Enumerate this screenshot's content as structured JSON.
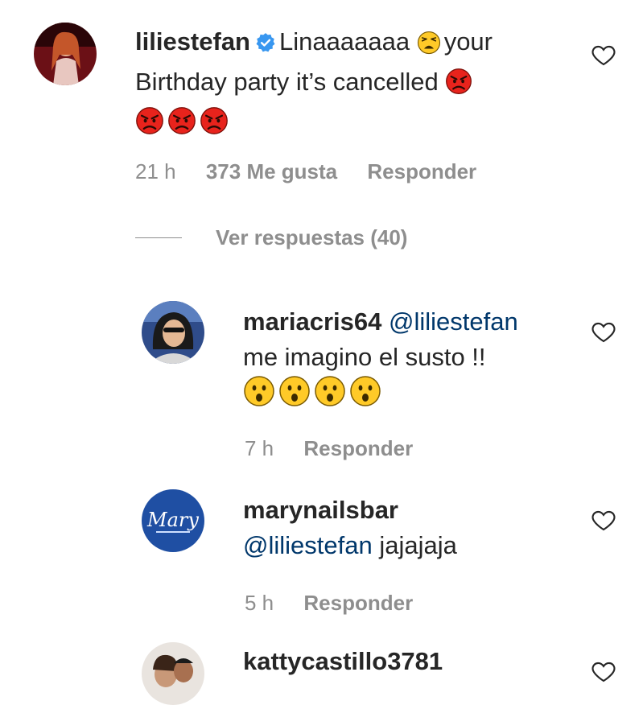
{
  "comments": [
    {
      "username": "liliestefan",
      "verified": true,
      "text_1": "Linaaaaaaa",
      "text_2": "your",
      "text_3": "Birthday party it’s cancelled",
      "time": "21 h",
      "likes": "373 Me gusta",
      "reply": "Responder"
    },
    {
      "username": "mariacris64",
      "mention": "@liliestefan",
      "text": "me imagino el susto !!",
      "time": "7 h",
      "reply": "Responder"
    },
    {
      "username": "marynailsbar",
      "mention": "@liliestefan",
      "text": "jajajaja",
      "time": "5 h",
      "reply": "Responder"
    },
    {
      "username": "kattycastillo3781"
    }
  ],
  "view_replies": "Ver respuestas (40)",
  "avatar_logo_text": "Mary",
  "icons": {
    "like": "heart-outline-icon",
    "verified": "verified-badge-icon",
    "emoji_weary": "weary-face-emoji",
    "emoji_angry": "angry-face-emoji",
    "emoji_astonished": "astonished-face-emoji"
  },
  "colors": {
    "mention": "#00376b",
    "verified": "#3897f0",
    "meta": "#8e8e8e"
  }
}
